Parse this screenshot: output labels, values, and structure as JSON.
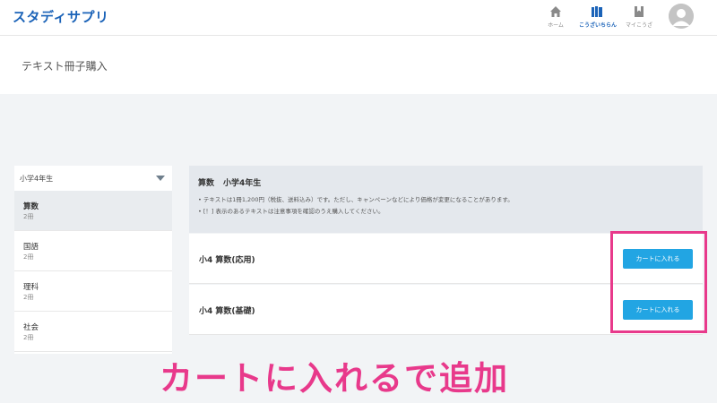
{
  "header": {
    "logo": "スタディサプリ",
    "nav": [
      {
        "label": "ホーム",
        "icon": "home-icon"
      },
      {
        "label": "こうざいちらん",
        "icon": "books-icon"
      },
      {
        "label": "マイこうざ",
        "icon": "bookmark-icon"
      }
    ],
    "avatar_icon": "user-avatar-icon"
  },
  "page": {
    "title": "テキスト冊子購入"
  },
  "sidebar": {
    "grade_select": "小学4年生",
    "items": [
      {
        "name": "算数",
        "count": "2冊"
      },
      {
        "name": "国語",
        "count": "2冊"
      },
      {
        "name": "理科",
        "count": "2冊"
      },
      {
        "name": "社会",
        "count": "2冊"
      }
    ]
  },
  "main": {
    "subject": "算数",
    "grade": "小学4年生",
    "notes": [
      "• テキストは1冊1,200円（税抜、送料込み）です。ただし、キャンペーンなどにより価格が変更になることがあります。",
      "• [！] 表示のあるテキストは注意事項を確認のうえ購入してください。"
    ],
    "books": [
      {
        "name": "小4 算数(応用)",
        "button": "カートに入れる"
      },
      {
        "name": "小4 算数(基礎)",
        "button": "カートに入れる"
      }
    ]
  },
  "annotation": {
    "caption": "カートに入れるで追加"
  },
  "colors": {
    "brand": "#1b63b8",
    "button": "#22a5e3",
    "highlight": "#e8398b"
  }
}
